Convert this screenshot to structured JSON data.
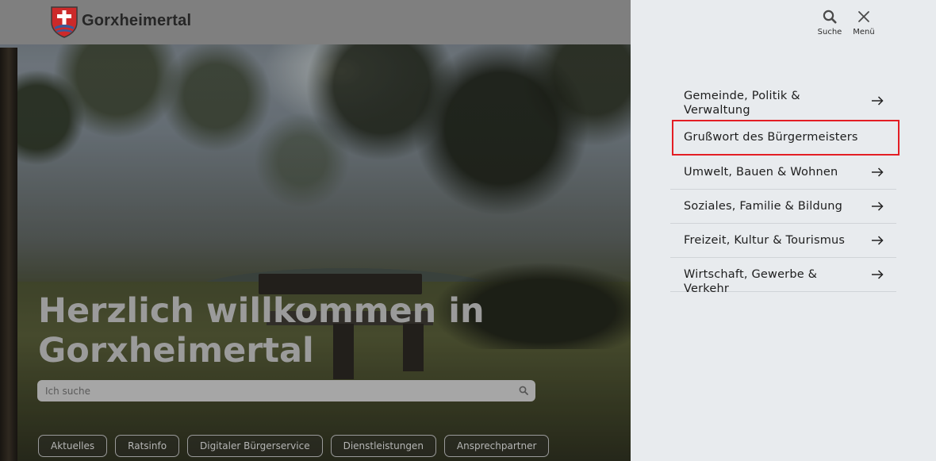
{
  "header": {
    "site_name": "Gorxheimertal",
    "logo_icon": "coat-of-arms-icon"
  },
  "hero": {
    "title": "Herzlich willkommen in Gorxheimertal",
    "search": {
      "placeholder": "Ich suche",
      "icon": "search-icon"
    },
    "quick_links": [
      {
        "label": "Aktuelles"
      },
      {
        "label": "Ratsinfo"
      },
      {
        "label": "Digitaler Bürgerservice"
      },
      {
        "label": "Dienstleistungen"
      },
      {
        "label": "Ansprechpartner"
      }
    ]
  },
  "menu": {
    "search_label": "Suche",
    "close_label": "Menü",
    "items": [
      {
        "label": "Gemeinde, Politik & Verwaltung",
        "has_arrow": true
      },
      {
        "label": "Grußwort des Bürgermeisters",
        "has_arrow": false,
        "highlighted": true
      },
      {
        "label": "Umwelt, Bauen & Wohnen",
        "has_arrow": true
      },
      {
        "label": "Soziales, Familie & Bildung",
        "has_arrow": true
      },
      {
        "label": "Freizeit, Kultur & Tourismus",
        "has_arrow": true
      },
      {
        "label": "Wirtschaft, Gewerbe & Verkehr",
        "has_arrow": true
      }
    ]
  },
  "colors": {
    "highlight_border": "#e31e24",
    "panel_bg": "#e8ebee",
    "header_bg": "#7f7f7f"
  }
}
